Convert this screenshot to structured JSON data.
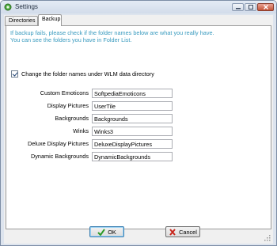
{
  "window": {
    "title": "Settings",
    "icons": {
      "app": "settings-app-icon",
      "minimize": "minimize-icon",
      "maximize": "maximize-icon",
      "close": "close-icon"
    }
  },
  "tabs": [
    {
      "label": "Directories",
      "selected": false
    },
    {
      "label": "Backup",
      "selected": true
    }
  ],
  "backup": {
    "info_lines": [
      "If backup fails, please check if the folder names below are what you really have.",
      "You can see the folders you have in Folder List."
    ],
    "info_color": "#3a9bbf",
    "change_names": {
      "label": "Change the folder names under WLM data directory",
      "checked": true
    },
    "fields": [
      {
        "label": "Custom Emoticons",
        "value": "SoftpediaEmoticons"
      },
      {
        "label": "Display Pictures",
        "value": "UserTile"
      },
      {
        "label": "Backgrounds",
        "value": "Backgrounds"
      },
      {
        "label": "Winks",
        "value": "Winks3"
      },
      {
        "label": "Deluxe Display Pictures",
        "value": "DeluxeDisplayPictures"
      },
      {
        "label": "Dynamic Backgrounds",
        "value": "DynamicBackgrounds"
      }
    ]
  },
  "buttons": {
    "ok": {
      "label": "OK",
      "icon": "green-check-icon"
    },
    "cancel": {
      "label": "Cancel",
      "icon": "red-x-icon"
    }
  }
}
